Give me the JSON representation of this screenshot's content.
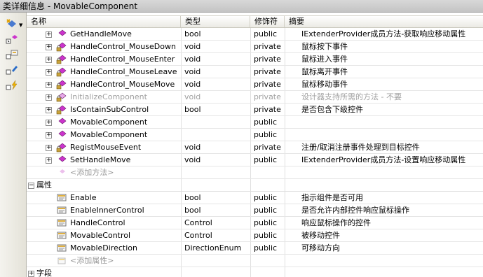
{
  "window": {
    "title": "类详细信息 - MovableComponent"
  },
  "toolbar": {
    "buttons": [
      {
        "icon": "new-member-icon"
      },
      {
        "icon": "method-icon"
      },
      {
        "icon": "property-icon"
      },
      {
        "icon": "field-icon"
      },
      {
        "icon": "event-icon"
      }
    ]
  },
  "columns": {
    "name": "名称",
    "type": "类型",
    "modifier": "修饰符",
    "summary": "摘要"
  },
  "methods": [
    {
      "name": "GetHandleMove",
      "type": "bool",
      "modifier": "public",
      "summary": "IExtenderProvider成员方法-获取响应移动属性",
      "access": "public",
      "disabled": false
    },
    {
      "name": "HandleControl_MouseDown",
      "type": "void",
      "modifier": "private",
      "summary": "鼠标按下事件",
      "access": "private",
      "disabled": false
    },
    {
      "name": "HandleControl_MouseEnter",
      "type": "void",
      "modifier": "private",
      "summary": "鼠标进入事件",
      "access": "private",
      "disabled": false
    },
    {
      "name": "HandleControl_MouseLeave",
      "type": "void",
      "modifier": "private",
      "summary": "鼠标离开事件",
      "access": "private",
      "disabled": false
    },
    {
      "name": "HandleControl_MouseMove",
      "type": "void",
      "modifier": "private",
      "summary": "鼠标移动事件",
      "access": "private",
      "disabled": false
    },
    {
      "name": "InitializeComponent",
      "type": "void",
      "modifier": "private",
      "summary": "设计器支持所需的方法 - 不要",
      "access": "private",
      "disabled": true
    },
    {
      "name": "IsContainSubControl",
      "type": "bool",
      "modifier": "private",
      "summary": "是否包含下级控件",
      "access": "private",
      "disabled": false
    },
    {
      "name": "MovableComponent",
      "type": "",
      "modifier": "public",
      "summary": "",
      "access": "public",
      "disabled": false
    },
    {
      "name": "MovableComponent",
      "type": "",
      "modifier": "public",
      "summary": "",
      "access": "public",
      "disabled": false
    },
    {
      "name": "RegistMouseEvent",
      "type": "void",
      "modifier": "private",
      "summary": "注册/取消注册事件处理到目标控件",
      "access": "private",
      "disabled": false
    },
    {
      "name": "SetHandleMove",
      "type": "void",
      "modifier": "public",
      "summary": "IExtenderProvider成员方法-设置响应移动属性",
      "access": "public",
      "disabled": false
    }
  ],
  "add_method_label": "<添加方法>",
  "properties_group": "属性",
  "properties": [
    {
      "name": "Enable",
      "type": "bool",
      "modifier": "public",
      "summary": "指示组件是否可用"
    },
    {
      "name": "EnableInnerControl",
      "type": "bool",
      "modifier": "public",
      "summary": "是否允许内部控件响应鼠标操作"
    },
    {
      "name": "HandleControl",
      "type": "Control",
      "modifier": "public",
      "summary": "响应鼠标操作的控件"
    },
    {
      "name": "MovableControl",
      "type": "Control",
      "modifier": "public",
      "summary": "被移动控件"
    },
    {
      "name": "MovableDirection",
      "type": "DirectionEnum",
      "modifier": "public",
      "summary": "可移动方向"
    }
  ],
  "add_property_label": "<添加属性>",
  "fields_group": "字段",
  "colors": {
    "method": "#cc33cc",
    "property": "#e0b040",
    "lock": "#707070"
  }
}
